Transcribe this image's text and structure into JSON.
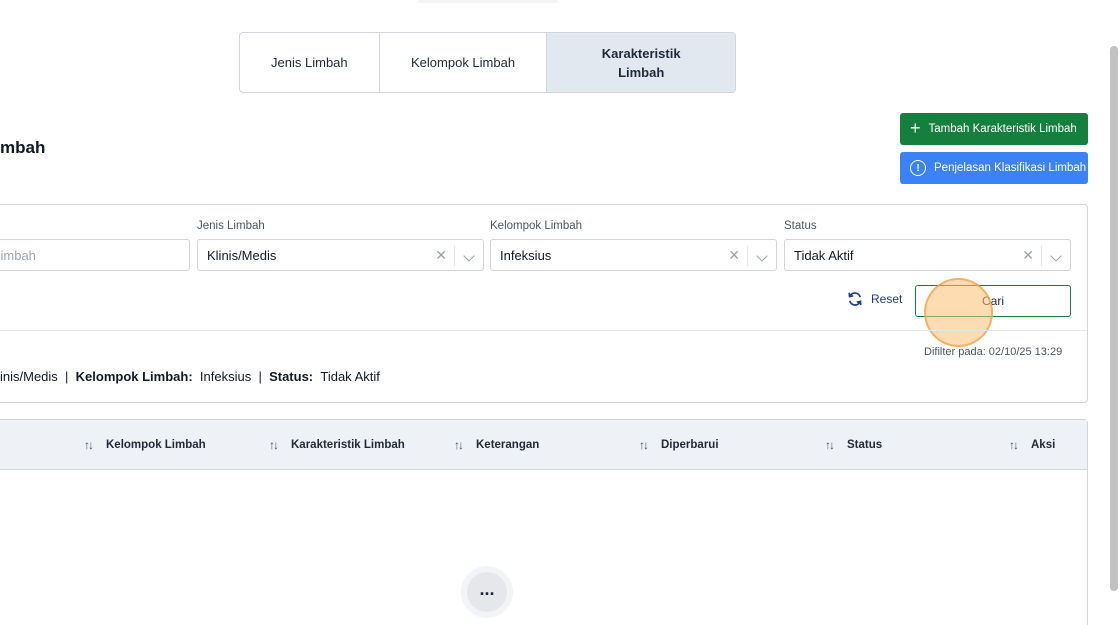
{
  "tabs": [
    {
      "label": "Jenis Limbah"
    },
    {
      "label": "Kelompok Limbah"
    },
    {
      "label": "Karakteristik Limbah",
      "active": true
    }
  ],
  "page": {
    "title": "mbah"
  },
  "actions": {
    "add_label": "Tambah Karakteristik Limbah",
    "info_label": "Penjelasan Klasifikasi Limbah"
  },
  "filters": {
    "search": {
      "placeholder": "tik limbah"
    },
    "jenis": {
      "label": "Jenis Limbah",
      "value": "Klinis/Medis"
    },
    "kelompok": {
      "label": "Kelompok Limbah",
      "value": "Infeksius"
    },
    "status": {
      "label": "Status",
      "value": "Tidak Aktif"
    },
    "reset_label": "Reset",
    "search_button_label": "Cari",
    "filtered_at": "Difilter pada: 02/10/25 13:29"
  },
  "summary": {
    "jenis_value": "inis/Medis",
    "sep1": "|",
    "kelompok_key": "Kelompok Limbah:",
    "kelompok_value": "Infeksius",
    "sep2": "|",
    "status_key": "Status:",
    "status_value": "Tidak Aktif"
  },
  "table": {
    "columns": [
      "Kelompok Limbah",
      "Karakteristik Limbah",
      "Keterangan",
      "Diperbarui",
      "Status",
      "Aksi"
    ]
  },
  "icons": {
    "sort": "sort-arrows-icon",
    "more": "more-horizontal-icon"
  },
  "colors": {
    "primary_green": "#15803d",
    "info_blue": "#3b82f6",
    "active_tab": "#e2e8f0"
  }
}
